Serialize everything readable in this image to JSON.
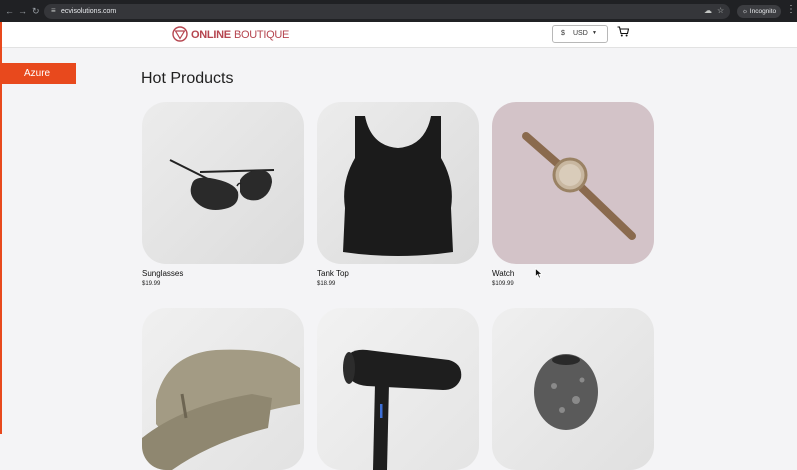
{
  "browser": {
    "url": "ecvisolutions.com",
    "incognito_label": "Incognito"
  },
  "header": {
    "logo_bold": "ONLINE",
    "logo_light": "BOUTIQUE",
    "currency_symbol": "$",
    "currency_code": "USD"
  },
  "badge": {
    "label": "Azure"
  },
  "section": {
    "title": "Hot Products"
  },
  "products": [
    {
      "name": "Sunglasses",
      "price": "$19.99"
    },
    {
      "name": "Tank Top",
      "price": "$18.99"
    },
    {
      "name": "Watch",
      "price": "$109.99"
    },
    {
      "name": "",
      "price": ""
    },
    {
      "name": "",
      "price": ""
    },
    {
      "name": "",
      "price": ""
    }
  ],
  "colors": {
    "accent": "#e8491d",
    "brand": "#b5454f"
  }
}
